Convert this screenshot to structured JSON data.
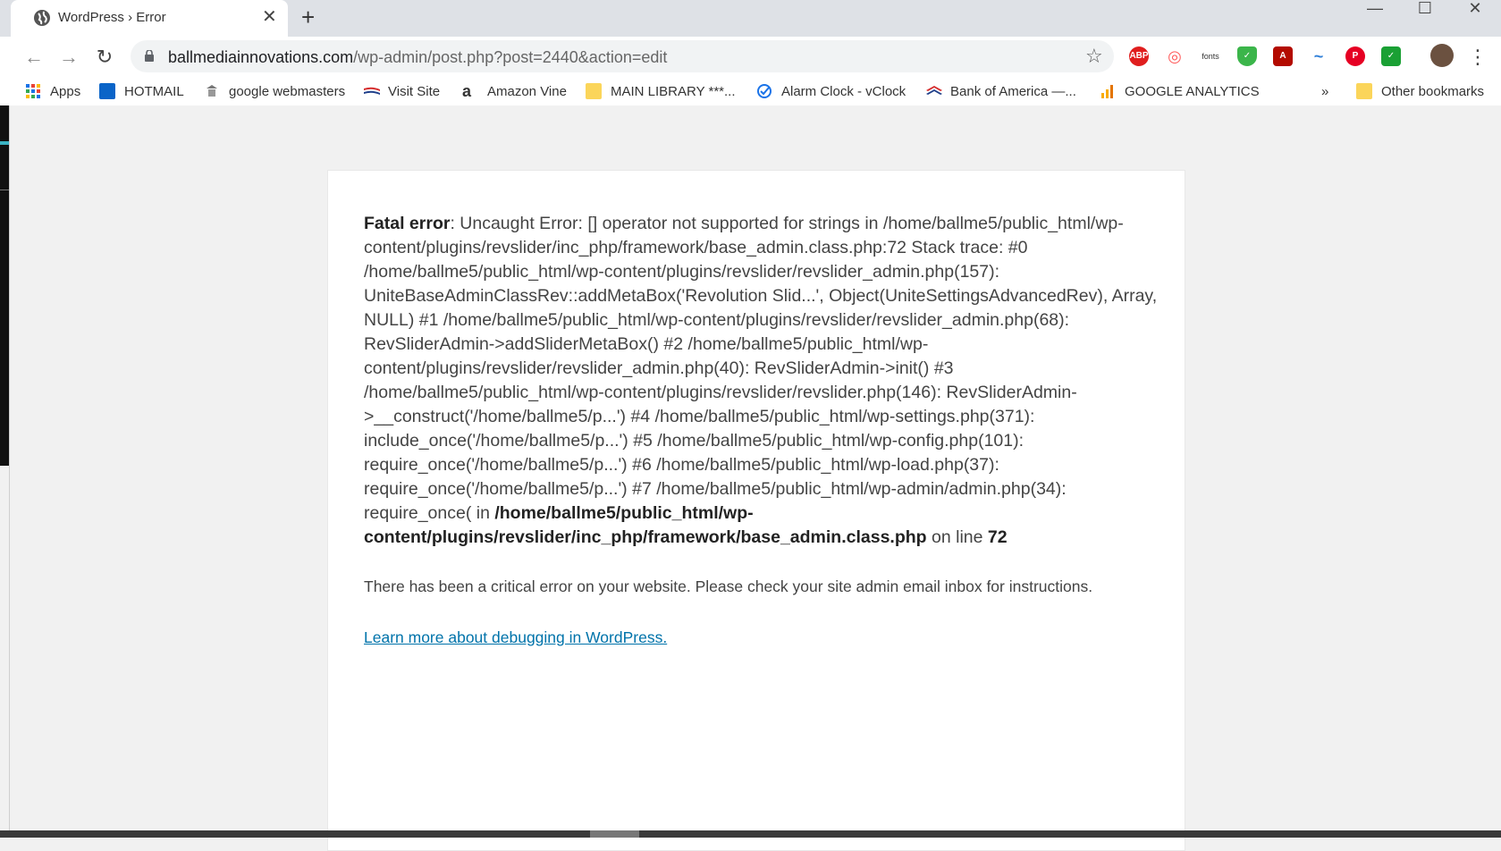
{
  "window": {
    "tab_title": "WordPress › Error",
    "tab_close": "✕",
    "new_tab": "+",
    "minimize": "—",
    "maximize": "☐",
    "close": "✕"
  },
  "toolbar": {
    "back": "←",
    "forward": "→",
    "reload": "↻",
    "url_host": "ballmediainnovations.com",
    "url_path": "/wp-admin/post.php?post=2440&action=edit",
    "star": "☆",
    "menu": "⋮",
    "extensions": [
      {
        "name": "adblock-plus-icon",
        "label": "ABP",
        "color": "#e01e1e"
      },
      {
        "name": "lastpass-icon",
        "label": "◎",
        "color": "#ff6666"
      },
      {
        "name": "fonts-icon",
        "label": "fonts",
        "color": "#ffffff"
      },
      {
        "name": "shield-check-icon",
        "label": "✓",
        "color": "#3bb54a"
      },
      {
        "name": "adobe-acrobat-icon",
        "label": "A",
        "color": "#b30b00"
      },
      {
        "name": "bird-icon",
        "label": "~",
        "color": "#4a90d9"
      },
      {
        "name": "pinterest-icon",
        "label": "P",
        "color": "#e60023"
      },
      {
        "name": "checkmark-icon",
        "label": "✓",
        "color": "#1aa034"
      }
    ]
  },
  "bookmarks": {
    "items": [
      {
        "label": "Apps"
      },
      {
        "label": "HOTMAIL"
      },
      {
        "label": "google webmasters"
      },
      {
        "label": "Visit Site"
      },
      {
        "label": "Amazon Vine"
      },
      {
        "label": "MAIN LIBRARY ***..."
      },
      {
        "label": "Alarm Clock - vClock"
      },
      {
        "label": "Bank of America —..."
      },
      {
        "label": "GOOGLE ANALYTICS"
      }
    ],
    "overflow": "»",
    "other": "Other bookmarks"
  },
  "error": {
    "fatal_label": "Fatal error",
    "fatal_text": ": Uncaught Error: [] operator not supported for strings in /home/ballme5/public_html/wp-content/plugins/revslider/inc_php/framework/base_admin.class.php:72 Stack trace: #0 /home/ballme5/public_html/wp-content/plugins/revslider/revslider_admin.php(157): UniteBaseAdminClassRev::addMetaBox('Revolution Slid...', Object(UniteSettingsAdvancedRev), Array, NULL) #1 /home/ballme5/public_html/wp-content/plugins/revslider/revslider_admin.php(68): RevSliderAdmin->addSliderMetaBox() #2 /home/ballme5/public_html/wp-content/plugins/revslider/revslider_admin.php(40): RevSliderAdmin->init() #3 /home/ballme5/public_html/wp-content/plugins/revslider/revslider.php(146): RevSliderAdmin->__construct('/home/ballme5/p...') #4 /home/ballme5/public_html/wp-settings.php(371): include_once('/home/ballme5/p...') #5 /home/ballme5/public_html/wp-config.php(101): require_once('/home/ballme5/p...') #6 /home/ballme5/public_html/wp-load.php(37): require_once('/home/ballme5/p...') #7 /home/ballme5/public_html/wp-admin/admin.php(34): require_once( in ",
    "file": "/home/ballme5/public_html/wp-content/plugins/revslider/inc_php/framework/base_admin.class.php",
    "on_line": " on line ",
    "line": "72",
    "critical_message": "There has been a critical error on your website. Please check your site admin email inbox for instructions.",
    "learn_more": "Learn more about debugging in WordPress."
  }
}
